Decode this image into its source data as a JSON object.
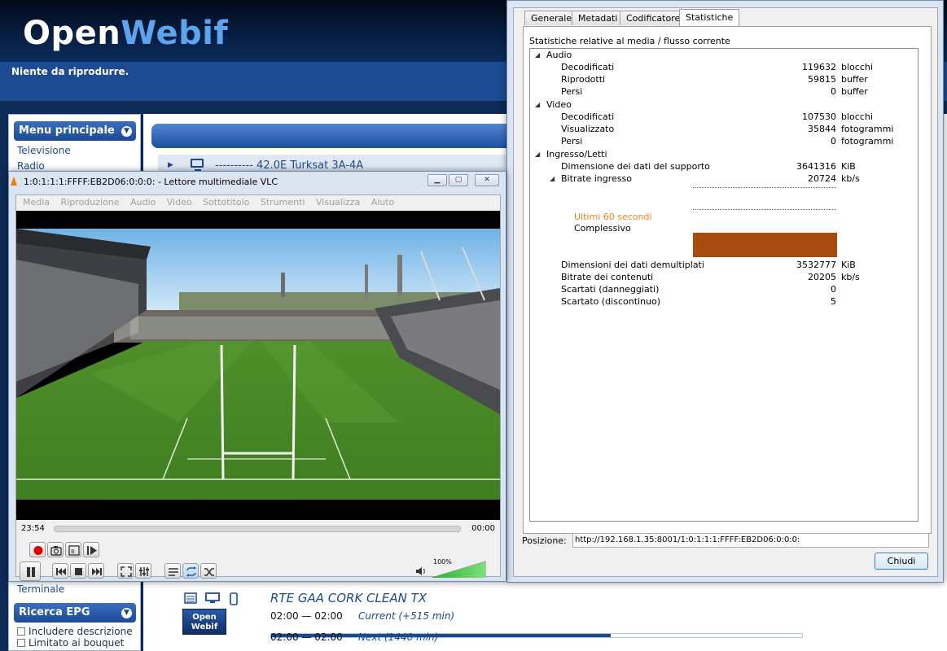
{
  "openwebif": {
    "logo_part1": "Open",
    "logo_part2": "Webif",
    "now_playing": "Niente da riprodurre.",
    "main_menu": {
      "title": "Menu principale",
      "items": [
        "Televisione",
        "Radio"
      ],
      "bottom_item": "Terminale"
    },
    "epg_search": {
      "title": "Ricerca EPG",
      "include_description": "Includere descrizione",
      "limit_bouquet": "Limitato ai bouquet"
    },
    "satellite": "---------- 42.0E Turksat 3A-4A",
    "channel": {
      "name": "RTE GAA CORK CLEAN TX",
      "logo_line1": "Open",
      "logo_line2": "Webif",
      "current_time": "02:00 — 02:00",
      "current_label": "Current",
      "current_extra": "(+515 min)",
      "next_time": "02:00 — 02:00",
      "next_label": "Next",
      "next_extra": "(1440 min)",
      "progress": 0.64
    }
  },
  "stats_window": {
    "tabs": [
      "Generale",
      "Metadati",
      "Codificatore",
      "Statistiche"
    ],
    "active_tab": "Statistiche",
    "subtitle": "Statistiche relative al media / flusso corrente",
    "audio": {
      "label": "Audio",
      "rows": [
        {
          "label": "Decodificati",
          "value": "119632",
          "unit": "blocchi"
        },
        {
          "label": "Riprodotti",
          "value": "59815",
          "unit": "buffer"
        },
        {
          "label": "Persi",
          "value": "0",
          "unit": "buffer"
        }
      ]
    },
    "video": {
      "label": "Video",
      "rows": [
        {
          "label": "Decodificati",
          "value": "107530",
          "unit": "blocchi"
        },
        {
          "label": "Visualizzato",
          "value": "35844",
          "unit": "fotogrammi"
        },
        {
          "label": "Persi",
          "value": "0",
          "unit": "fotogrammi"
        }
      ]
    },
    "input": {
      "label": "Ingresso/Letti",
      "media_size_label": "Dimensione dei dati del supporto",
      "media_size_value": "3641316",
      "media_size_unit": "KiB",
      "bitrate_label": "Bitrate ingresso",
      "bitrate_value": "20724",
      "bitrate_unit": "kb/s",
      "last60": "Ultimi 60 secondi",
      "overall": "Complessivo",
      "demux_size_label": "Dimensioni dei dati demultiplati",
      "demux_size_value": "3532777",
      "demux_size_unit": "KiB",
      "content_bitrate_label": "Bitrate dei contenuti",
      "content_bitrate_value": "20205",
      "content_bitrate_unit": "kb/s",
      "discarded_corrupt_label": "Scartati (danneggiati)",
      "discarded_corrupt_value": "0",
      "discarded_disc_label": "Scartato (discontinuo)",
      "discarded_disc_value": "5"
    },
    "position_label": "Posizione:",
    "position_value": "http://192.168.1.35:8001/1:0:1:1:1:FFFF:EB2D06:0:0:0:",
    "close_label": "Chiudi",
    "colors": {
      "graph_bar": "#a84b0f",
      "last60": "#e9841c"
    }
  },
  "vlc_window": {
    "title": "1:0:1:1:1:FFFF:EB2D06:0:0:0: - Lettore multimediale VLC",
    "menu": [
      "Media",
      "Riproduzione",
      "Audio",
      "Video",
      "Sottotitolo",
      "Strumenti",
      "Visualizza",
      "Aiuto"
    ],
    "elapsed": "23:54",
    "remaining": "00:00",
    "volume": "100%",
    "volume_level": 1.0
  }
}
